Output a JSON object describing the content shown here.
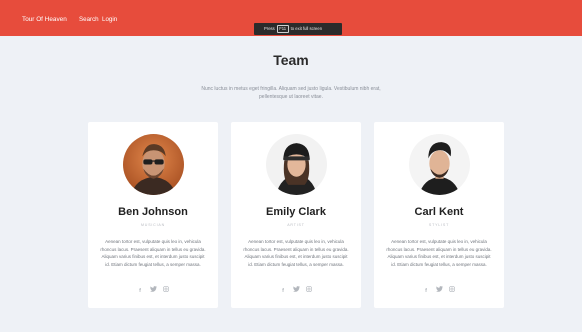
{
  "navbar": {
    "brand": "Tour Of Heaven",
    "links": [
      "Search",
      "Login"
    ],
    "bg_color": "#e74c3c"
  },
  "fullscreen_toast": {
    "prefix": "Press",
    "key": "F11",
    "suffix": "to exit full screen"
  },
  "section": {
    "title": "Team",
    "intro": "Nunc luctus in metus eget fringilla. Aliquam sed justo ligula. Vestibulum nibh erat, pellentesque ut laoreet vitae."
  },
  "team": [
    {
      "name": "Ben Johnson",
      "role": "Musician",
      "bio": "Aenean tortor est, vulputate quis leo in, vehicula rhoncus lacus. Praesent aliquam in tellus eu gravida. Aliquam varius finibus est, et interdum justo suscipit id. Etiam dictum feugiat tellus, a semper massa.",
      "socials": [
        "facebook-icon",
        "twitter-icon",
        "instagram-icon"
      ]
    },
    {
      "name": "Emily Clark",
      "role": "Artist",
      "bio": "Aenean tortor est, vulputate quis leo in, vehicula rhoncus lacus. Praesent aliquam in tellus eu gravida. Aliquam varius finibus est, et interdum justo suscipit id. Etiam dictum feugiat tellus, a semper massa.",
      "socials": [
        "facebook-icon",
        "twitter-icon",
        "instagram-icon"
      ]
    },
    {
      "name": "Carl Kent",
      "role": "Stylist",
      "bio": "Aenean tortor est, vulputate quis leo in, vehicula rhoncus lacus. Praesent aliquam in tellus eu gravida. Aliquam varius finibus est, et interdum justo suscipit id. Etiam dictum feugiat tellus, a semper massa.",
      "socials": [
        "facebook-icon",
        "twitter-icon",
        "instagram-icon"
      ]
    }
  ]
}
